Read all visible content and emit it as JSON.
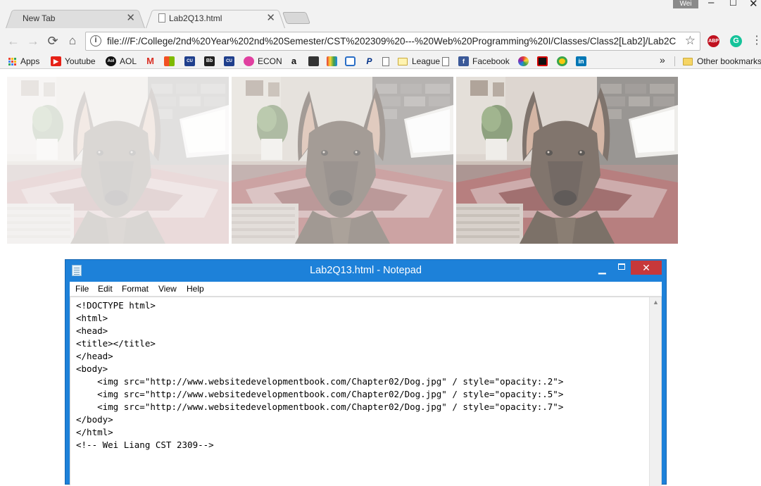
{
  "browser": {
    "tabs": [
      {
        "title": "New Tab",
        "active": false
      },
      {
        "title": "Lab2Q13.html",
        "active": true
      }
    ],
    "user_badge": "Wei",
    "url": "file:///F:/College/2nd%20Year%202nd%20Semester/CST%202309%20---%20Web%20Programming%20I/Classes/Class2[Lab2]/Lab2C",
    "bookmarks": [
      {
        "label": "Apps",
        "icon": "apps-grid-icon"
      },
      {
        "label": "Youtube",
        "icon": "youtube-icon"
      },
      {
        "label": "AOL",
        "icon": "aol-icon"
      },
      {
        "label": "",
        "icon": "gmail-icon"
      },
      {
        "label": "",
        "icon": "windows-icon"
      },
      {
        "label": "",
        "icon": "cuny-icon"
      },
      {
        "label": "",
        "icon": "blackboard-icon"
      },
      {
        "label": "",
        "icon": "cuny-icon"
      },
      {
        "label": "ECON",
        "icon": "econ-icon"
      },
      {
        "label": "",
        "icon": "amazon-icon"
      },
      {
        "label": "",
        "icon": "gift-icon"
      },
      {
        "label": "",
        "icon": "tv-icon"
      },
      {
        "label": "",
        "icon": "clock-icon"
      },
      {
        "label": "",
        "icon": "paypal-icon"
      },
      {
        "label": "",
        "icon": "page-icon"
      },
      {
        "label": "League",
        "icon": "folder-icon"
      },
      {
        "label": "",
        "icon": "page-icon"
      },
      {
        "label": "Facebook",
        "icon": "facebook-icon"
      },
      {
        "label": "",
        "icon": "color-wheel-icon"
      },
      {
        "label": "",
        "icon": "red-app-icon"
      },
      {
        "label": "",
        "icon": "ring-icon"
      },
      {
        "label": "",
        "icon": "linkedin-icon"
      }
    ],
    "bookmarks_overflow": "»",
    "other_bookmarks": "Other bookmarks",
    "extensions": {
      "abp": "ABP",
      "grammarly": "G"
    }
  },
  "page": {
    "images": [
      {
        "alt": "Dog",
        "opacity": 0.2
      },
      {
        "alt": "Dog",
        "opacity": 0.5
      },
      {
        "alt": "Dog",
        "opacity": 0.7
      }
    ]
  },
  "notepad": {
    "title": "Lab2Q13.html - Notepad",
    "menu": [
      "File",
      "Edit",
      "Format",
      "View",
      "Help"
    ],
    "content": "<!DOCTYPE html>\n<html>\n<head>\n<title></title>\n</head>\n<body>\n    <img src=\"http://www.websitedevelopmentbook.com/Chapter02/Dog.jpg\" / style=\"opacity:.2\">\n    <img src=\"http://www.websitedevelopmentbook.com/Chapter02/Dog.jpg\" / style=\"opacity:.5\">\n    <img src=\"http://www.websitedevelopmentbook.com/Chapter02/Dog.jpg\" / style=\"opacity:.7\">\n</body>\n</html>\n<!-- Wei Liang CST 2309-->"
  }
}
